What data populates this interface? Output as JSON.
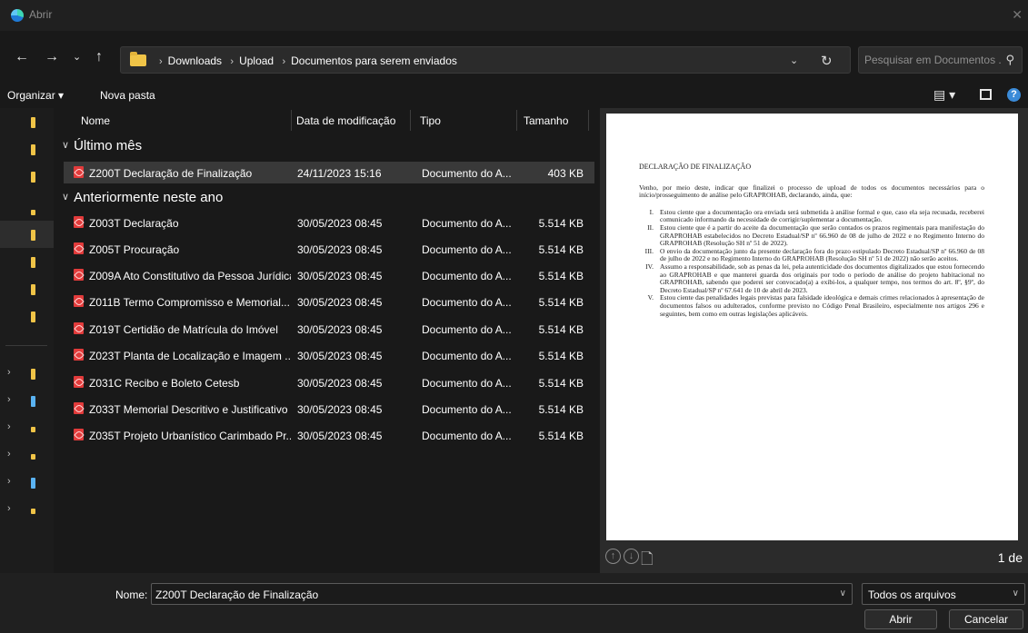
{
  "window": {
    "title": "Abrir"
  },
  "address": {
    "crumbs": [
      "Downloads",
      "Upload",
      "Documentos para serem enviados"
    ],
    "search_placeholder": "Pesquisar em Documentos ..."
  },
  "toolbar": {
    "organize": "Organizar ▾",
    "new_folder": "Nova pasta"
  },
  "columns": {
    "name": "Nome",
    "date": "Data de modificação",
    "type": "Tipo",
    "size": "Tamanho"
  },
  "groups": [
    {
      "label": "Último mês",
      "files": [
        {
          "name": "Z200T Declaração de Finalização",
          "date": "24/11/2023 15:16",
          "type": "Documento do A...",
          "size": "403 KB"
        }
      ]
    },
    {
      "label": "Anteriormente neste ano",
      "files": [
        {
          "name": "Z003T  Declaração",
          "date": "30/05/2023 08:45",
          "type": "Documento do A...",
          "size": "5.514 KB"
        },
        {
          "name": "Z005T  Procuração",
          "date": "30/05/2023 08:45",
          "type": "Documento do A...",
          "size": "5.514 KB"
        },
        {
          "name": "Z009A  Ato Constitutivo da Pessoa Jurídica",
          "date": "30/05/2023 08:45",
          "type": "Documento do A...",
          "size": "5.514 KB"
        },
        {
          "name": "Z011B  Termo  Compromisso e Memorial...",
          "date": "30/05/2023 08:45",
          "type": "Documento do A...",
          "size": "5.514 KB"
        },
        {
          "name": "Z019T  Certidão de Matrícula do Imóvel",
          "date": "30/05/2023 08:45",
          "type": "Documento do A...",
          "size": "5.514 KB"
        },
        {
          "name": "Z023T  Planta de Localização e Imagem ...",
          "date": "30/05/2023 08:45",
          "type": "Documento do A...",
          "size": "5.514 KB"
        },
        {
          "name": "Z031C  Recibo e Boleto Cetesb",
          "date": "30/05/2023 08:45",
          "type": "Documento do A...",
          "size": "5.514 KB"
        },
        {
          "name": "Z033T  Memorial Descritivo e Justificativo",
          "date": "30/05/2023 08:45",
          "type": "Documento do A...",
          "size": "5.514 KB"
        },
        {
          "name": "Z035T  Projeto Urbanístico Carimbado Pr...",
          "date": "30/05/2023 08:45",
          "type": "Documento do A...",
          "size": "5.514 KB"
        }
      ]
    }
  ],
  "preview": {
    "doc_title": "DECLARAÇÃO DE FINALIZAÇÃO",
    "intro": "Venho, por meio deste, indicar que finalizei o processo de upload de todos os documentos necessários para o início/prosseguimento de análise pelo GRAPROHAB, declarando, ainda, que:",
    "items": [
      {
        "num": "I.",
        "text": "Estou ciente que a documentação ora enviada será submetida à análise formal e que, caso ela seja recusada, receberei comunicado informando da necessidade de corrigir/suplementar a documentação."
      },
      {
        "num": "II.",
        "text": "Estou ciente que é a partir do aceite da documentação que serão contados os prazos regimentais para manifestação do GRAPROHAB estabelecidos no Decreto Estadual/SP nº 66.960 de 08 de julho de 2022 e no Regimento Interno do GRAPROHAB (Resolução SH nº 51 de 2022)."
      },
      {
        "num": "III.",
        "text": "O envio da documentação junto da presente declaração fora do prazo estipulado Decreto Estadual/SP nº 66.960 de 08 de julho de 2022 e no Regimento Interno do GRAPROHAB (Resolução SH nº 51 de 2022) não serão aceitos."
      },
      {
        "num": "IV.",
        "text": "Assumo a responsabilidade, sob as penas da lei, pela autenticidade dos documentos digitalizados que estou fornecendo ao GRAPROHAB e que manterei guarda dos originais por todo o período de análise do projeto habitacional no GRAPROHAB, sabendo que poderei ser convocado(a) a exibi-los, a qualquer tempo, nos termos do art. 8º, §9º, do Decreto Estadual/SP nº 67.641 de 10 de abril de 2023."
      },
      {
        "num": "V.",
        "text": "Estou ciente das penalidades legais previstas para falsidade ideológica e demais crimes relacionados à apresentação de documentos falsos ou adulterados, conforme previsto no Código Penal Brasileiro, especialmente nos artigos 296 e seguintes, bem como em outras legislações aplicáveis."
      }
    ],
    "page_indicator": "1 de"
  },
  "bottom": {
    "name_label": "Nome:",
    "filename_value": "Z200T Declaração de Finalização",
    "filetype_value": "Todos os arquivos",
    "open_label": "Abrir",
    "cancel_label": "Cancelar"
  },
  "colors": {
    "pdf_icon": "#e23b3b",
    "folder": "#f0c447",
    "selection": "#393939"
  }
}
